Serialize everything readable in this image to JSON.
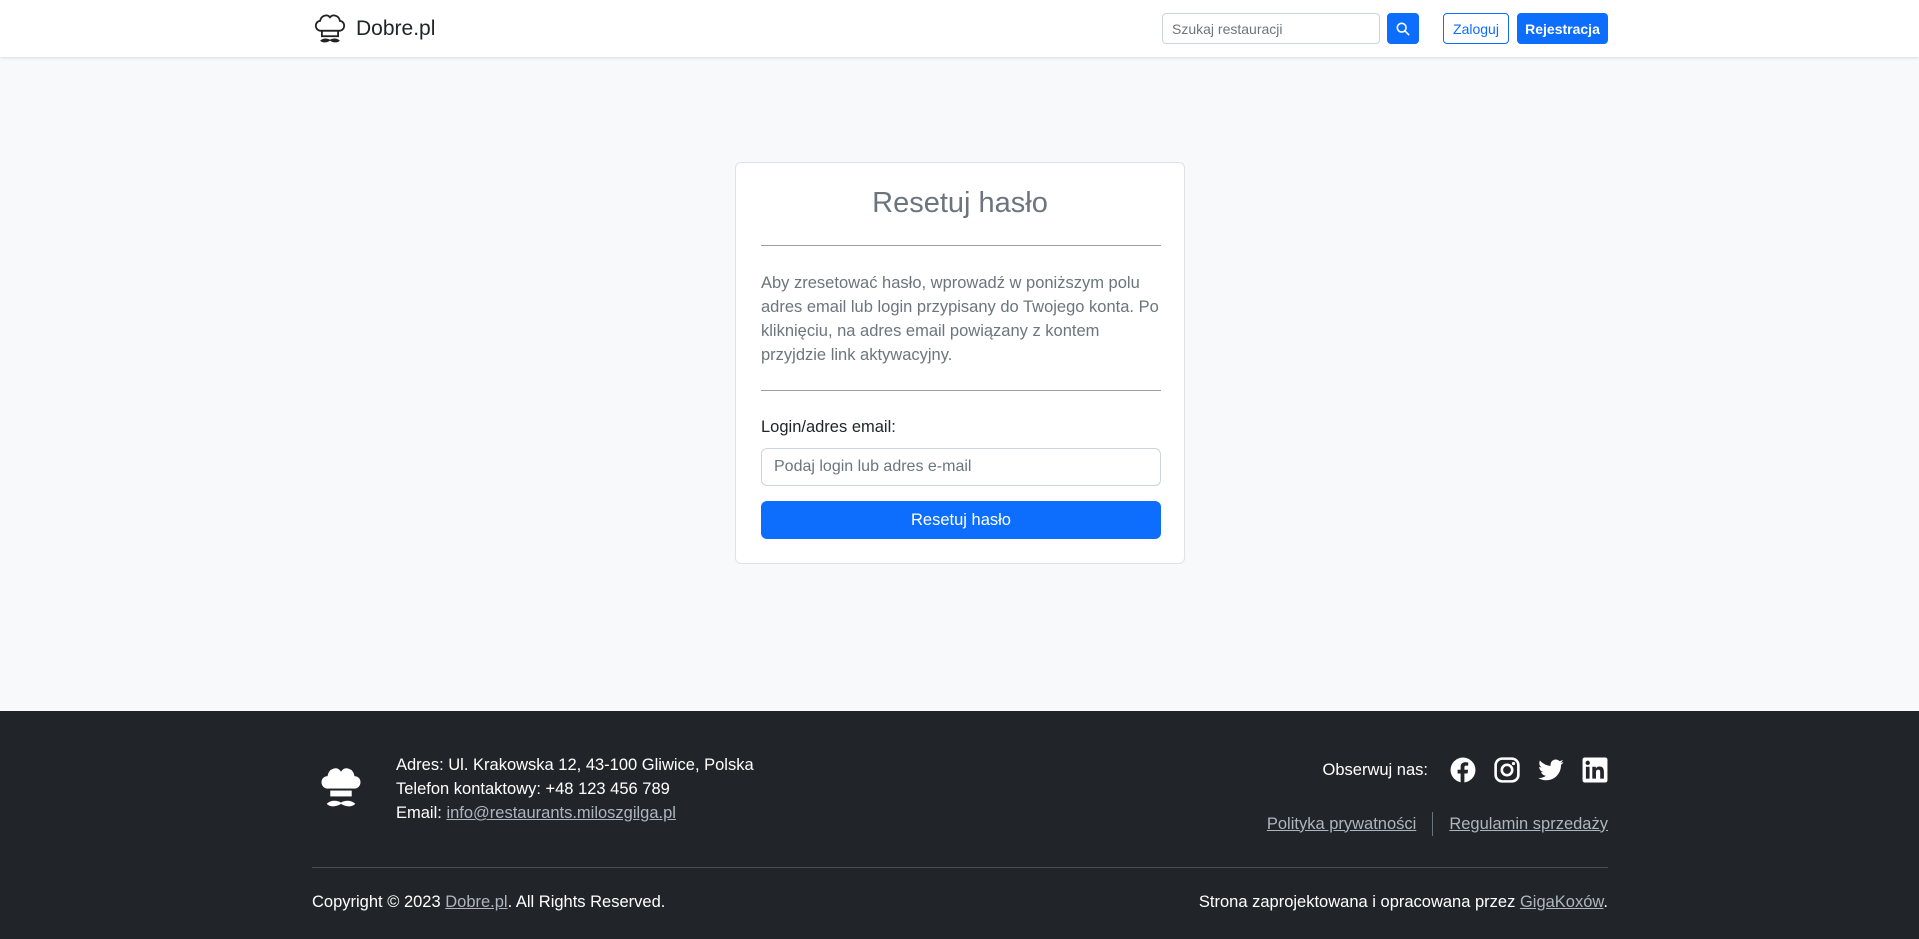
{
  "navbar": {
    "brand_name": "Dobre.pl",
    "search_placeholder": "Szukaj restauracji",
    "login_label": "Zaloguj",
    "register_label": "Rejestracja"
  },
  "reset_card": {
    "title": "Resetuj hasło",
    "description": "Aby zresetować hasło, wprowadź w poniższym polu adres email lub login przypisany do Twojego konta. Po kliknięciu, na adres email powiązany z kontem przyjdzie link aktywacyjny.",
    "field_label": "Login/adres email:",
    "field_placeholder": "Podaj login lub adres e-mail",
    "submit_label": "Resetuj hasło"
  },
  "footer": {
    "address": "Adres: Ul. Krakowska 12, 43-100 Gliwice, Polska",
    "phone": "Telefon kontaktowy: +48 123 456 789",
    "email_prefix": "Email: ",
    "email_link": "info@restaurants.miloszgilga.pl",
    "follow_label": "Obserwuj nas:",
    "social_icons": [
      "facebook-icon",
      "instagram-icon",
      "twitter-icon",
      "linkedin-icon"
    ],
    "privacy_link": "Polityka prywatności",
    "terms_link": "Regulamin sprzedaży",
    "copyright_prefix": "Copyright © 2023 ",
    "copyright_link": "Dobre.pl",
    "copyright_suffix": ". All Rights Reserved.",
    "designed_prefix": "Strona zaprojektowana i opracowana przez ",
    "designed_link": "GigaKoxów",
    "designed_suffix": "."
  },
  "colors": {
    "primary": "#0d6efd",
    "page_background": "#f8f9fa",
    "footer_background": "#212529",
    "muted_text": "#6c757d"
  }
}
